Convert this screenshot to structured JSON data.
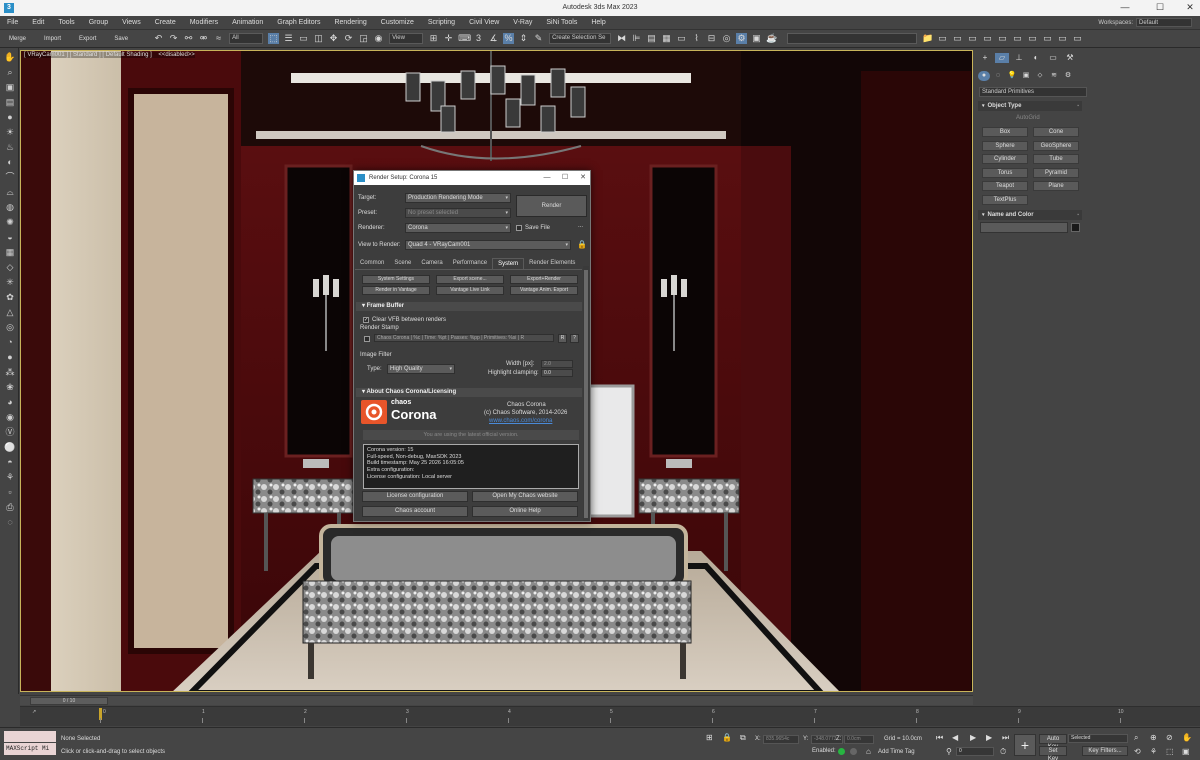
{
  "title": "Autodesk 3ds Max 2023",
  "app_icon": "3",
  "window_controls": [
    "—",
    "☐",
    "✕"
  ],
  "menu": [
    "File",
    "Edit",
    "Tools",
    "Group",
    "Views",
    "Create",
    "Modifiers",
    "Animation",
    "Graph Editors",
    "Rendering",
    "Customize",
    "Scripting",
    "Civil View",
    "V-Ray",
    "SiNi Tools",
    "Help"
  ],
  "workspaces": {
    "label": "Workspaces:",
    "value": "Default"
  },
  "toolbar": {
    "merge": "Merge",
    "import": "Import",
    "export": "Export",
    "save": "Save",
    "filter": "All",
    "view": "View",
    "selection_set": "Create Selection Se",
    "snap_count": "3"
  },
  "viewport": {
    "label": "[ VRayCam001 ] [ Standard ] [ Default Shading ]",
    "disabled": "<<disabled>>"
  },
  "command_panel": {
    "category": "Standard Primitives",
    "object_type": "Object Type",
    "autogrid": "AutoGrid",
    "primitives": [
      "Box",
      "Cone",
      "Sphere",
      "GeoSphere",
      "Cylinder",
      "Tube",
      "Torus",
      "Pyramid",
      "Teapot",
      "Plane",
      "TextPlus"
    ],
    "name_and_color": "Name and Color",
    "color": "#1a1a1a"
  },
  "render_setup": {
    "title": "Render Setup: Corona 15",
    "target_label": "Target:",
    "target": "Production Rendering Mode",
    "preset_label": "Preset:",
    "preset": "No preset selected",
    "renderer_label": "Renderer:",
    "renderer": "Corona",
    "save_file": "Save File",
    "more": "...",
    "render_button": "Render",
    "view_label": "View to Render:",
    "view": "Quad 4 - VRayCam001",
    "tabs": [
      "Common",
      "Scene",
      "Camera",
      "Performance",
      "System",
      "Render Elements"
    ],
    "active_tab": "System",
    "system_buttons": [
      "System Settings",
      "Export scene...",
      "Export+Render",
      "Render in Vantage",
      "Vantage Live Link",
      "Vantage Anim. Export"
    ],
    "frame_buffer": {
      "header": "Frame Buffer",
      "clear_vfb": "Clear VFB between renders",
      "render_stamp_label": "Render Stamp",
      "render_stamp": "Chaos Corona | %c | Time: %pt | Passes: %pp | Primitives: %si | R",
      "stamp_r": "R",
      "stamp_help": "?",
      "image_filter_label": "Image Filter",
      "type_label": "Type:",
      "type": "High Quality",
      "width_label": "Width [px]:",
      "width": "2.0",
      "clamp_label": "Highlight clamping:",
      "clamp": "0.0"
    },
    "about": {
      "header": "About Chaos Corona/Licensing",
      "logo_top": "chaos",
      "logo_bottom": "Corona",
      "product": "Chaos Corona",
      "copyright": "(c) Chaos Software, 2014-2026",
      "link": "www.chaos.com/corona",
      "latest": "You are using the latest official version.",
      "info_lines": [
        "Corona version: 15",
        "Full-speed, Non-debug, MaxSDK 2023",
        "Build timestamp: May 25 2026 16:05:05",
        "Extra configuration:",
        "License configuration: Local server"
      ],
      "buttons": [
        "License configuration",
        "Open My Chaos website",
        "Chaos account",
        "Online Help"
      ]
    }
  },
  "timeline": {
    "frame": "0 / 10",
    "ticks": [
      "0",
      "1",
      "2",
      "3",
      "4",
      "5",
      "6",
      "7",
      "8",
      "9",
      "10"
    ],
    "extra": "↗"
  },
  "status": {
    "maxscript": "MAXScript Mi",
    "selection": "None Selected",
    "prompt": "Click or click-and-drag to select objects",
    "x_label": "X:",
    "x": "835.9654c",
    "y_label": "Y:",
    "y": "-348.0773",
    "z_label": "Z:",
    "z": "0.0cm",
    "grid": "Grid = 10.0cm",
    "enabled": "Enabled:",
    "add_time_tag": "Add Time Tag",
    "auto_key": "Auto Key",
    "set_key": "Set Key",
    "selected": "Selected",
    "key_filters": "Key Filters...",
    "frame_field": "0"
  },
  "colors": {
    "accent": "#5a7fa8",
    "viewport_border": "#c8b45a",
    "corona_orange": "#e8552a"
  }
}
